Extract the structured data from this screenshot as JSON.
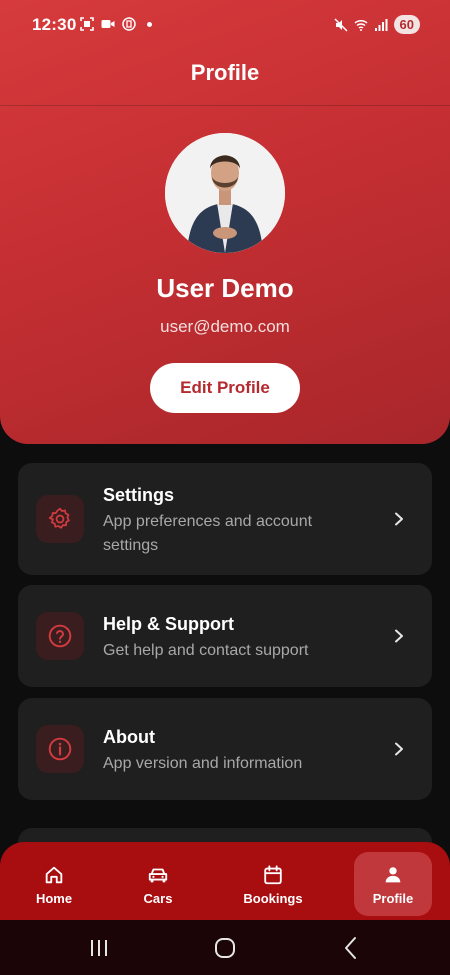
{
  "status_bar": {
    "time": "12:30",
    "battery": "60",
    "left_icons": [
      "screenshot-icon",
      "video-icon",
      "ring-icon",
      "dot"
    ],
    "right_icons": [
      "mute-icon",
      "wifi-icon",
      "signal-icon",
      "battery"
    ]
  },
  "header": {
    "title": "Profile",
    "user_name": "User Demo",
    "email": "user@demo.com",
    "edit_label": "Edit Profile"
  },
  "menu": [
    {
      "title": "Settings",
      "subtitle": "App preferences and account settings",
      "icon": "gear-icon"
    },
    {
      "title": "Help & Support",
      "subtitle": "Get help and contact support",
      "icon": "help-icon"
    },
    {
      "title": "About",
      "subtitle": "App version and information",
      "icon": "info-icon"
    }
  ],
  "bottom_nav": {
    "items": [
      {
        "label": "Home",
        "icon": "home-icon"
      },
      {
        "label": "Cars",
        "icon": "car-icon"
      },
      {
        "label": "Bookings",
        "icon": "calendar-icon"
      },
      {
        "label": "Profile",
        "icon": "person-icon"
      }
    ],
    "active": "Profile"
  },
  "colors": {
    "header_red": "#c52f33",
    "nav_red": "#a80d10",
    "accent": "#d23b3f",
    "card_bg": "#1f1f1f",
    "background": "#0d0d0d"
  }
}
